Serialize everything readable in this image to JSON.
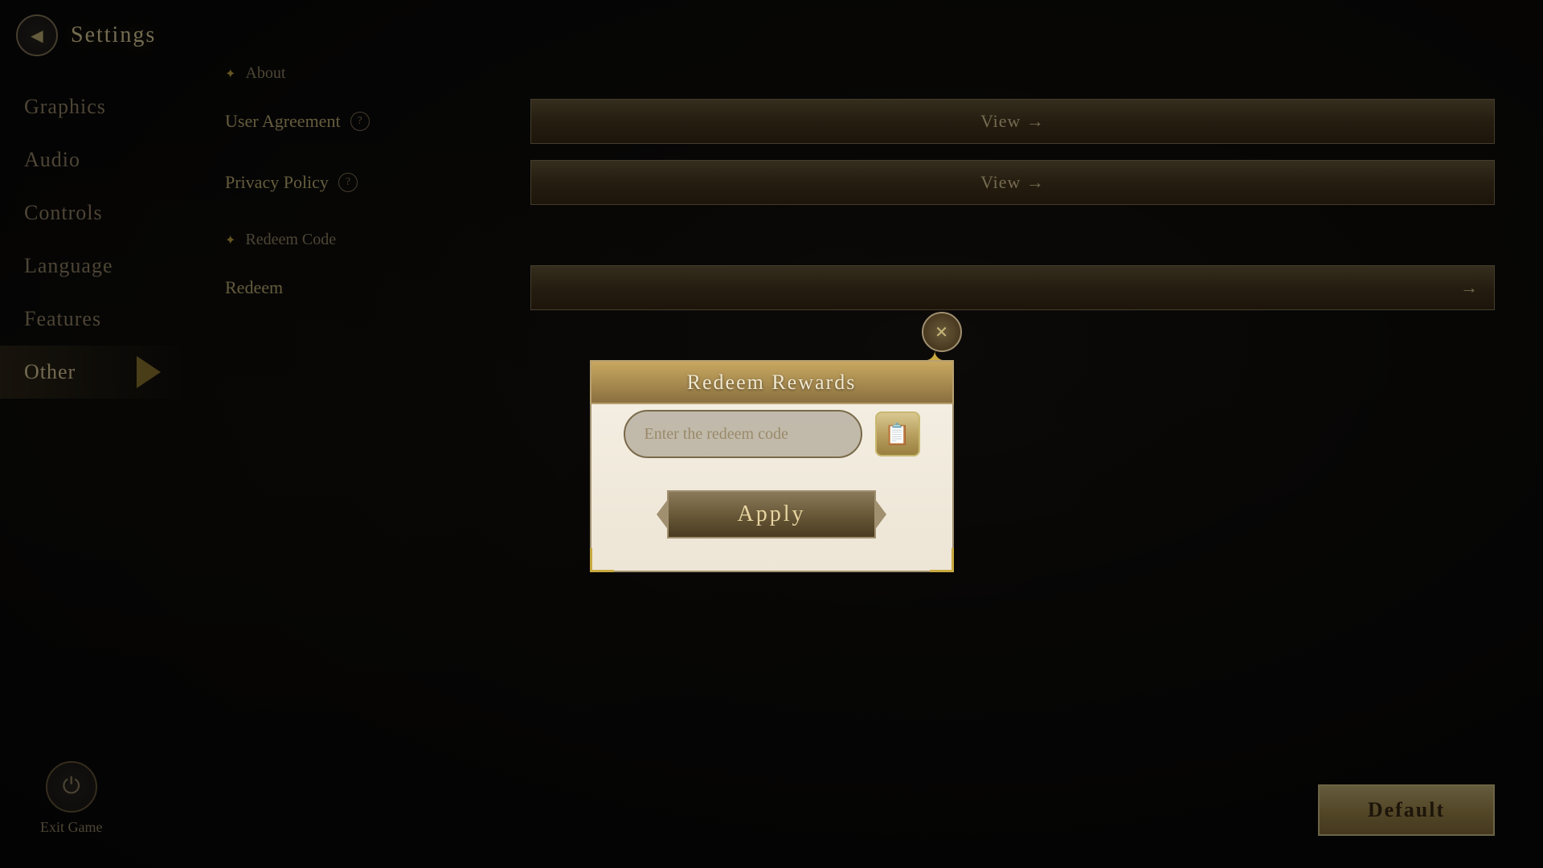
{
  "header": {
    "back_icon": "◀",
    "title": "Settings"
  },
  "sidebar": {
    "items": [
      {
        "id": "graphics",
        "label": "Graphics",
        "active": false
      },
      {
        "id": "audio",
        "label": "Audio",
        "active": false
      },
      {
        "id": "controls",
        "label": "Controls",
        "active": false
      },
      {
        "id": "language",
        "label": "Language",
        "active": false
      },
      {
        "id": "features",
        "label": "Features",
        "active": false
      },
      {
        "id": "other",
        "label": "Other",
        "active": true
      }
    ]
  },
  "exit": {
    "icon": "⏻",
    "label": "Exit Game"
  },
  "main": {
    "about_section": "About",
    "user_agreement_label": "User Agreement",
    "user_agreement_help": "?",
    "user_agreement_btn": "View →",
    "privacy_policy_label": "Privacy Policy",
    "privacy_policy_help": "?",
    "privacy_policy_btn": "View →",
    "redeem_section": "Redeem Code",
    "redeem_label": "Redeem",
    "redeem_btn": "→"
  },
  "default_btn": "Default",
  "modal": {
    "title": "Redeem Rewards",
    "close_icon": "✕",
    "input_placeholder": "Enter the redeem code",
    "clipboard_icon": "📋",
    "apply_label": "Apply"
  }
}
